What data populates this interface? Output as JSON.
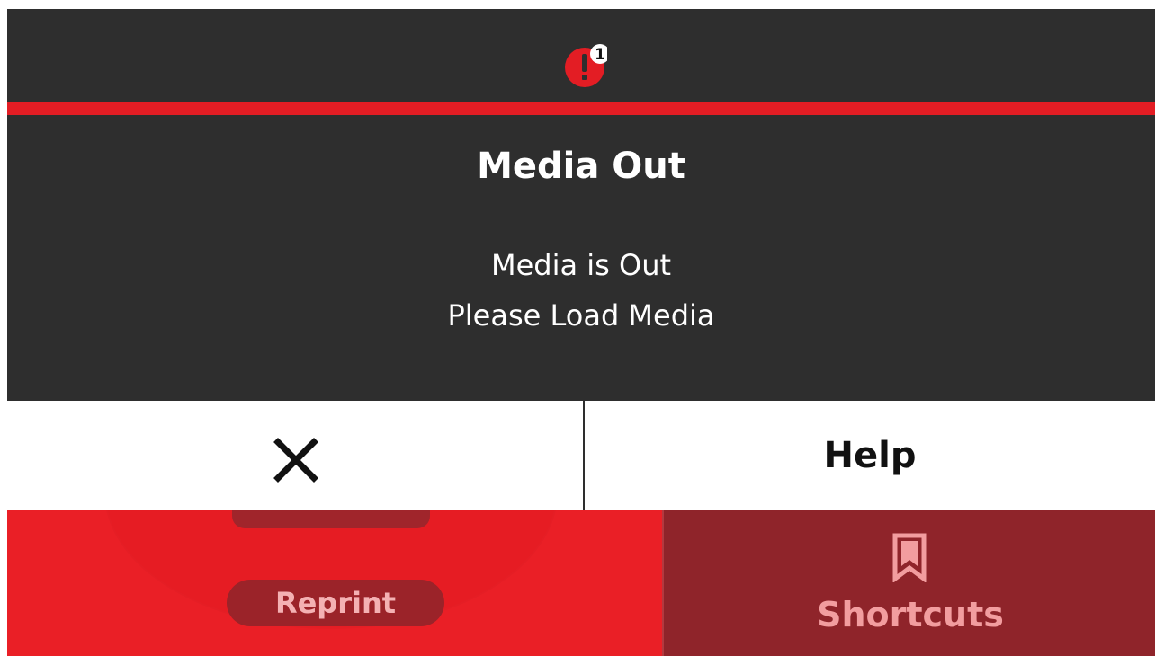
{
  "header": {
    "alert_icon": "alert-exclamation-icon",
    "alert_count": "1",
    "accent_color": "#e31d24"
  },
  "message": {
    "title": "Media Out",
    "line1": "Media is Out",
    "line2": "Please Load Media"
  },
  "actions": {
    "dismiss_icon": "close-icon",
    "help_label": "Help"
  },
  "bottom_bar": {
    "reprint_label": "Reprint",
    "shortcuts_icon": "bookmark-icon",
    "shortcuts_label": "Shortcuts",
    "home_color": "#ea1f26",
    "shortcuts_color": "#8f242a"
  }
}
